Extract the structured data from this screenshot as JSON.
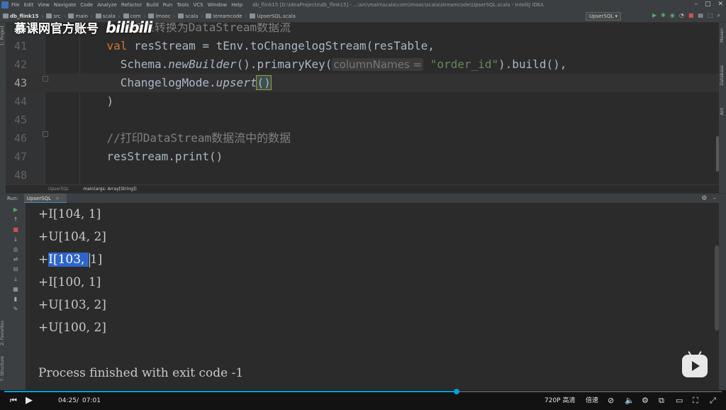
{
  "menubar": {
    "items": [
      "File",
      "Edit",
      "View",
      "Navigate",
      "Code",
      "Analyze",
      "Refactor",
      "Build",
      "Run",
      "Tools",
      "VCS",
      "Window",
      "Help"
    ],
    "window_title": "db_flink15 [D:\\IdeaProjects\\db_flink15] - ...\\src\\main\\scala\\com\\imooc\\scala\\streamcode\\UpserSQL.scala - IntelliJ IDEA"
  },
  "navbar": {
    "breadcrumbs": [
      "db_flink15",
      "src",
      "main",
      "scala",
      "com",
      "imooc",
      "scala",
      "streamcode",
      "UpserSQL.scala"
    ],
    "run_config": "UpserSQL ▾"
  },
  "watermark": {
    "text": "慕课网官方账号",
    "logo": "bilibili"
  },
  "editor": {
    "lines": [
      {
        "num": "40",
        "segments": [
          {
            "cls": "cm",
            "text": "    //将结果转换为DataStream数据流"
          }
        ]
      },
      {
        "num": "41",
        "segments": [
          {
            "cls": "kw",
            "text": "    val "
          },
          {
            "cls": "",
            "text": "resStream = tEnv.toChangelogStream(resTable,"
          }
        ]
      },
      {
        "num": "42",
        "segments": [
          {
            "cls": "",
            "text": "      Schema."
          },
          {
            "cls": "it",
            "text": "newBuilder"
          },
          {
            "cls": "",
            "text": "().primaryKey("
          },
          {
            "cls": "hint",
            "text": "columnNames ="
          },
          {
            "cls": "",
            "text": " "
          },
          {
            "cls": "str",
            "text": "\"order_id\""
          },
          {
            "cls": "",
            "text": ").build(),"
          }
        ]
      },
      {
        "num": "43",
        "current": true,
        "segments": [
          {
            "cls": "",
            "text": "      ChangelogMode."
          },
          {
            "cls": "it",
            "text": "upsert"
          },
          {
            "cls": "brace-hl",
            "text": "()"
          }
        ]
      },
      {
        "num": "44",
        "segments": [
          {
            "cls": "",
            "text": "    )"
          }
        ]
      },
      {
        "num": "45",
        "segments": [
          {
            "cls": "",
            "text": ""
          }
        ]
      },
      {
        "num": "46",
        "segments": [
          {
            "cls": "cm",
            "text": "    //打印DataStream数据流中的数据"
          }
        ]
      },
      {
        "num": "47",
        "segments": [
          {
            "cls": "",
            "text": "    resStream.print()"
          }
        ]
      },
      {
        "num": "48",
        "segments": [
          {
            "cls": "",
            "text": ""
          }
        ]
      }
    ]
  },
  "crumbbar": {
    "class_name": "UpserSQL",
    "method": "main(args: Array[String])"
  },
  "run_panel": {
    "label": "Run:",
    "tab": "UpserSQL"
  },
  "console": {
    "lines": [
      {
        "text": "+I[104, 1]"
      },
      {
        "text": "+U[104, 2]"
      },
      {
        "pre": "+",
        "sel": "I[103, ",
        "post": "1]"
      },
      {
        "text": "+I[100, 1]"
      },
      {
        "text": "+U[103, 2]"
      },
      {
        "text": "+U[100, 2]"
      },
      {
        "text": ""
      },
      {
        "text": "Process finished with exit code -1"
      }
    ]
  },
  "player": {
    "current_time": "04:25",
    "total_time": "07:01",
    "time_sep": "/",
    "progress": 0.63,
    "quality": "720P 高清",
    "speed": "倍速"
  },
  "colors": {
    "accent": "#00a1d6",
    "selection": "#2f65ca",
    "keyword": "#cc7832",
    "string": "#6a8759",
    "comment": "#808080"
  }
}
